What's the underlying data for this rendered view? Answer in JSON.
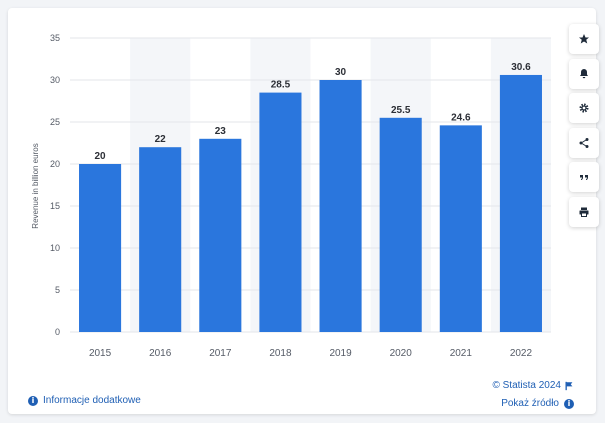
{
  "chart_data": {
    "type": "bar",
    "categories": [
      "2015",
      "2016",
      "2017",
      "2018",
      "2019",
      "2020",
      "2021",
      "2022"
    ],
    "values": [
      20,
      22,
      23,
      28.5,
      30,
      25.5,
      24.6,
      30.6
    ],
    "data_labels": [
      "20",
      "22",
      "23",
      "28.5",
      "30",
      "25.5",
      "24.6",
      "30.6"
    ],
    "title": "",
    "xlabel": "",
    "ylabel": "Revenue in billion euros",
    "ylim": [
      0,
      35
    ],
    "yticks": [
      0,
      5,
      10,
      15,
      20,
      25,
      30,
      35
    ],
    "grid": true,
    "bar_color": "#2a76dd",
    "stripe_color": "#f4f6f9"
  },
  "toolbar": {
    "icons": [
      "star-icon",
      "bell-icon",
      "gear-icon",
      "share-icon",
      "quote-icon",
      "print-icon"
    ],
    "color": "#1f2b3a"
  },
  "footer": {
    "info_label": "Informacje dodatkowe",
    "credit": "© Statista 2024",
    "source_label": "Pokaż źródło",
    "link_color": "#1f5fb4"
  }
}
